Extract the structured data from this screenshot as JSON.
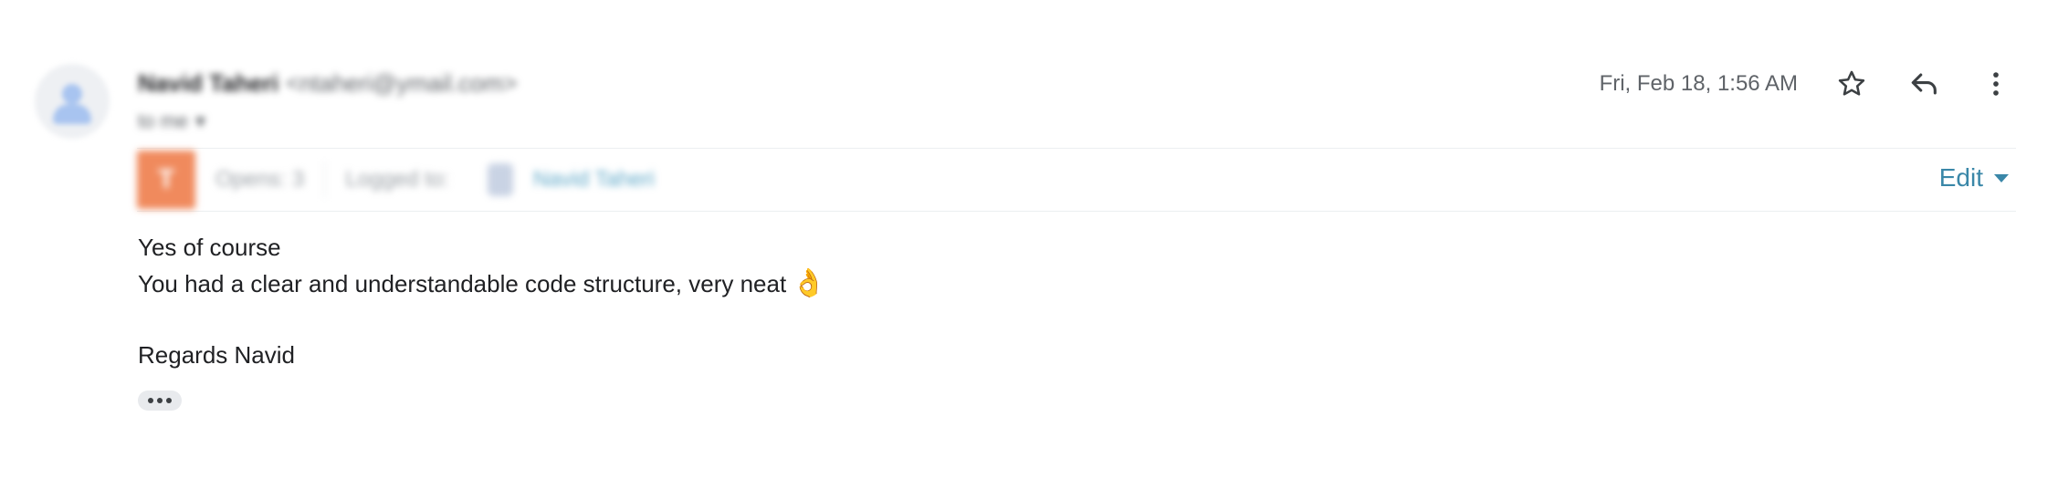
{
  "message": {
    "sender_name": "Navid Taheri",
    "sender_email": "<ntaheri@ymail.com>",
    "to_line": "to me",
    "timestamp": "Fri, Feb 18, 1:56 AM",
    "body_lines": [
      "Yes of course",
      "You had a clear and understandable code structure, very neat",
      "",
      "Regards Navid"
    ],
    "emoji": "👌"
  },
  "tracker": {
    "logo_letter": "T",
    "opens": "Opens: 3",
    "logged_to": "Logged to:",
    "contact": "Navid Taheri",
    "edit_label": "Edit"
  },
  "actions": {
    "star_icon": "star-icon",
    "reply_icon": "reply-icon",
    "more_icon": "more-vert-icon"
  },
  "colors": {
    "edit_accent": "#3a87a8",
    "tracker_logo": "#f08a5d"
  }
}
